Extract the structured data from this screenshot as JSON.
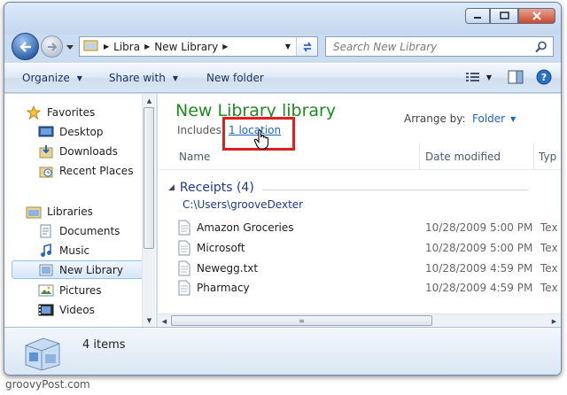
{
  "nav": {
    "breadcrumb": [
      "Libra",
      "New Library"
    ],
    "search_placeholder": "Search New Library"
  },
  "toolbar": {
    "organize": "Organize",
    "share_with": "Share with",
    "new_folder": "New folder"
  },
  "sidebar": {
    "favorites": "Favorites",
    "favorite_items": [
      {
        "label": "Desktop",
        "icon": "desktop-icon"
      },
      {
        "label": "Downloads",
        "icon": "downloads-icon"
      },
      {
        "label": "Recent Places",
        "icon": "recent-places-icon"
      }
    ],
    "libraries": "Libraries",
    "library_items": [
      {
        "label": "Documents",
        "icon": "documents-icon"
      },
      {
        "label": "Music",
        "icon": "music-icon"
      },
      {
        "label": "New Library",
        "icon": "library-icon",
        "selected": true
      },
      {
        "label": "Pictures",
        "icon": "pictures-icon"
      },
      {
        "label": "Videos",
        "icon": "videos-icon"
      }
    ]
  },
  "library": {
    "title": "New Library library",
    "includes_label": "Includes:",
    "location_link": "1 location",
    "arrange_label": "Arrange by:",
    "arrange_value": "Folder"
  },
  "columns": {
    "name": "Name",
    "date_modified": "Date modified",
    "type": "Typ"
  },
  "group": {
    "label": "Receipts (4)",
    "path": "C:\\Users\\grooveDexter"
  },
  "files": [
    {
      "name": "Amazon Groceries",
      "date": "10/28/2009 5:00 PM",
      "type": "Tex"
    },
    {
      "name": "Microsoft",
      "date": "10/28/2009 5:00 PM",
      "type": "Tex"
    },
    {
      "name": "Newegg.txt",
      "date": "10/28/2009 4:59 PM",
      "type": "Tex"
    },
    {
      "name": "Pharmacy",
      "date": "10/28/2009 4:59 PM",
      "type": "Tex"
    }
  ],
  "status": {
    "item_count": "4 items"
  },
  "watermark": "groovyPost.com",
  "colors": {
    "library_title": "#1f8a1f",
    "link": "#1a67c4",
    "highlight": "#e01e1e"
  }
}
